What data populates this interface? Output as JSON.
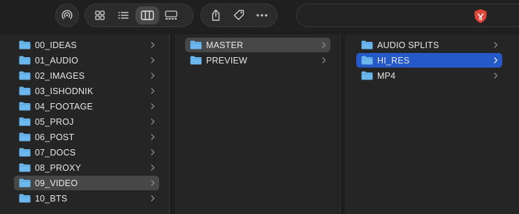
{
  "columns": [
    {
      "items": [
        {
          "label": "00_IDEAS",
          "selected": false
        },
        {
          "label": "01_AUDIO",
          "selected": false
        },
        {
          "label": "02_IMAGES",
          "selected": false
        },
        {
          "label": "03_ISHODNIK",
          "selected": false
        },
        {
          "label": "04_FOOTAGE",
          "selected": false
        },
        {
          "label": "05_PROJ",
          "selected": false
        },
        {
          "label": "06_POST",
          "selected": false
        },
        {
          "label": "07_DOCS",
          "selected": false
        },
        {
          "label": "08_PROXY",
          "selected": false
        },
        {
          "label": "09_VIDEO",
          "selected": true
        },
        {
          "label": "10_BTS",
          "selected": false
        }
      ]
    },
    {
      "items": [
        {
          "label": "MASTER",
          "selected": true
        },
        {
          "label": "PREVIEW",
          "selected": false
        }
      ]
    },
    {
      "items": [
        {
          "label": "AUDIO SPLITS",
          "selected": false
        },
        {
          "label": "HI_RES",
          "selected": true
        },
        {
          "label": "MP4",
          "selected": false
        }
      ]
    }
  ],
  "colors": {
    "folder": "#6cb8ee",
    "selection_active": "#2459c7",
    "selection_inactive": "#474747",
    "shield": "#e0453a"
  },
  "icons": [
    "airdrop-icon",
    "icon-view-icon",
    "list-view-icon",
    "column-view-icon",
    "gallery-view-icon",
    "share-icon",
    "tag-icon",
    "more-icon",
    "shield-icon",
    "folder-icon",
    "chevron-right-icon"
  ]
}
